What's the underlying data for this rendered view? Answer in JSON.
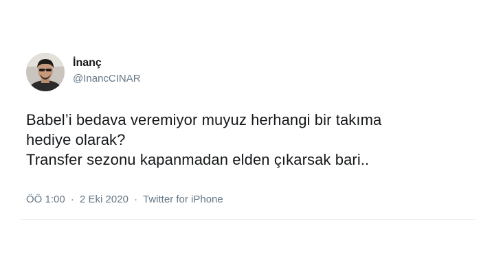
{
  "author": {
    "display_name": "İnanç",
    "handle": "@InancCINAR",
    "avatar_icon": "profile-photo"
  },
  "tweet": {
    "lines": [
      "Babel’i bedava veremiyor muyuz herhangi bir takıma",
      "hediye olarak?",
      "Transfer sezonu kapanmadan elden çıkarsak bari.."
    ]
  },
  "meta": {
    "time": "ÖÖ 1:00",
    "separator": "·",
    "date": "2 Eki 2020",
    "source": "Twitter for iPhone"
  },
  "colors": {
    "text_primary": "#14171a",
    "text_secondary": "#657786",
    "divider": "#e6ecf0"
  }
}
